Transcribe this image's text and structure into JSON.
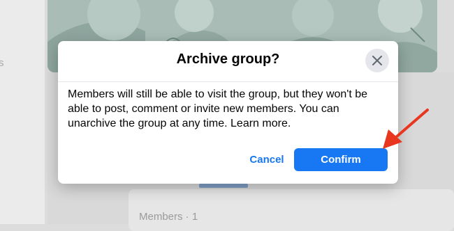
{
  "background": {
    "left_cut_text": "s",
    "members_label": "Members · 1"
  },
  "dialog": {
    "title": "Archive group?",
    "body": "Members will still be able to visit the group, but they won't be able to post, comment or invite new members. You can unarchive the group at any time. Learn more.",
    "cancel_label": "Cancel",
    "confirm_label": "Confirm",
    "close_icon": "close-icon"
  },
  "annotation": {
    "arrow_color": "#e8361f"
  },
  "colors": {
    "primary": "#1877f2",
    "title_text": "#050505",
    "close_bg": "#e4e6eb"
  }
}
